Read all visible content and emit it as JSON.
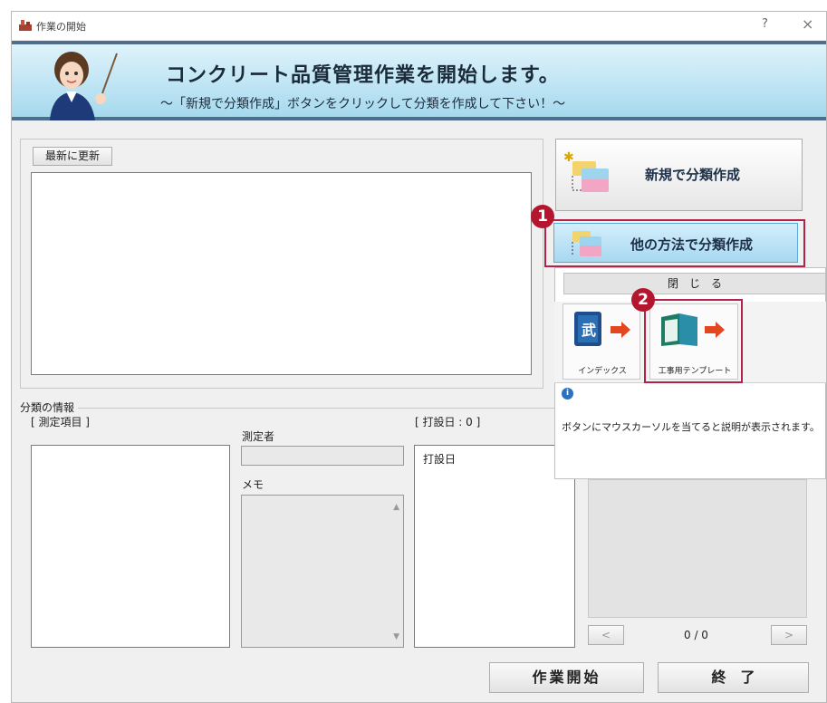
{
  "window": {
    "title": "作業の開始",
    "help": "?",
    "close": "×"
  },
  "banner": {
    "title": "コンクリート品質管理作業を開始します。",
    "subtitle": "～「新規で分類作成」ボタンをクリックして分類を作成して下さい！～"
  },
  "left": {
    "refresh_label": "最新に更新"
  },
  "info": {
    "group_label": "分類の情報",
    "items_label": "[ 測定項目 ]",
    "measurer_label": "測定者",
    "memo_label": "メモ",
    "pour_date_header": "[ 打設日 : 0 ]",
    "pour_date_col": "打設日"
  },
  "right": {
    "new_btn": "新規で分類作成",
    "other_btn": "他の方法で分類作成",
    "close_strip": "閉　じ　る",
    "index_label": "インデックス",
    "template_label": "工事用テンプレート",
    "info_text": "ボタンにマウスカーソルを当てると説明が表示されます。",
    "pager_prev": "<",
    "pager_text": "0 / 0",
    "pager_next": ">"
  },
  "footer": {
    "start_label": "作業開始",
    "end_label": "終　了"
  },
  "badges": {
    "one": "1",
    "two": "2"
  }
}
